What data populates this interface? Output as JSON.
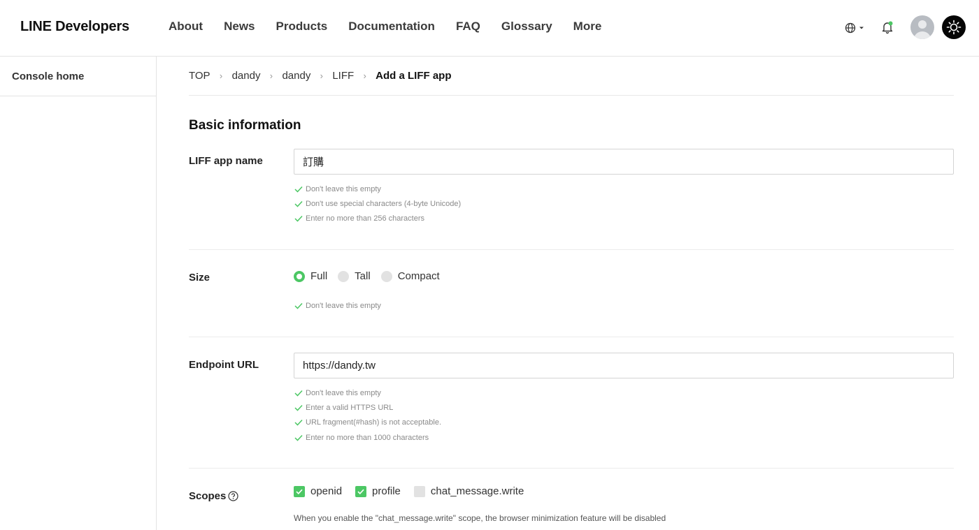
{
  "header": {
    "logo": "LINE Developers",
    "nav": [
      "About",
      "News",
      "Products",
      "Documentation",
      "FAQ",
      "Glossary",
      "More"
    ],
    "icons": [
      "globe-icon",
      "bell-icon",
      "avatar",
      "sun-icon"
    ],
    "notification_dot_color": "#4cc764"
  },
  "sidebar": {
    "items": [
      {
        "label": "Console home"
      }
    ]
  },
  "breadcrumb": [
    "TOP",
    "dandy",
    "dandy",
    "LIFF",
    "Add a LIFF app"
  ],
  "form": {
    "section_title": "Basic information",
    "app_name": {
      "label": "LIFF app name",
      "value": "訂購",
      "rules": [
        "Don't leave this empty",
        "Don't use special characters (4-byte Unicode)",
        "Enter no more than 256 characters"
      ]
    },
    "size": {
      "label": "Size",
      "options": [
        {
          "label": "Full",
          "selected": true
        },
        {
          "label": "Tall",
          "selected": false
        },
        {
          "label": "Compact",
          "selected": false
        }
      ],
      "rules": [
        "Don't leave this empty"
      ]
    },
    "endpoint": {
      "label": "Endpoint URL",
      "value": "https://dandy.tw",
      "rules": [
        "Don't leave this empty",
        "Enter a valid HTTPS URL",
        "URL fragment(#hash) is not acceptable.",
        "Enter no more than 1000 characters"
      ]
    },
    "scopes": {
      "label": "Scopes",
      "options": [
        {
          "label": "openid",
          "checked": true
        },
        {
          "label": "profile",
          "checked": true
        },
        {
          "label": "chat_message.write",
          "checked": false
        }
      ],
      "note": "When you enable the \"chat_message.write\" scope, the browser minimization feature will be disabled"
    }
  },
  "colors": {
    "accent": "#4cc764",
    "rule_text": "#8a8a8a",
    "border": "#d4d4d4"
  }
}
